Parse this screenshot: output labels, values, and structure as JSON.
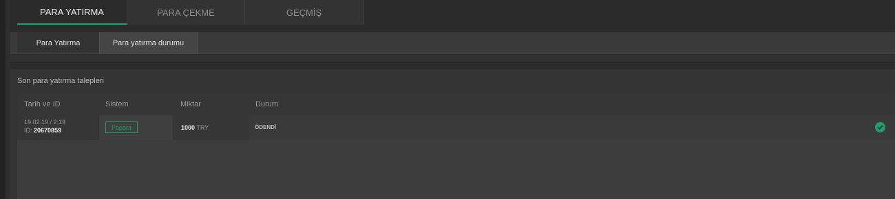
{
  "top_tabs": [
    {
      "label": "PARA YATIRMA",
      "active": true
    },
    {
      "label": "PARA ÇEKME",
      "active": false
    },
    {
      "label": "GEÇMİŞ",
      "active": false
    }
  ],
  "sub_tabs": [
    {
      "label": "Para Yatırma",
      "active": false
    },
    {
      "label": "Para yatırma durumu",
      "active": true
    }
  ],
  "panel": {
    "title": "Son para yatırma talepleri",
    "columns": [
      "Tarih ve ID",
      "Sistem",
      "Miktar",
      "Durum"
    ],
    "rows": [
      {
        "date": "19.02.19 / 2:19",
        "id_label": "ID:",
        "id": "20670859",
        "system": "Papara",
        "amount": "1000",
        "currency": "TRY",
        "status": "ÖDENDİ",
        "status_icon": "check-circle-icon"
      }
    ]
  },
  "colors": {
    "accent": "#1fa06a",
    "background": "#2b2b2b"
  }
}
